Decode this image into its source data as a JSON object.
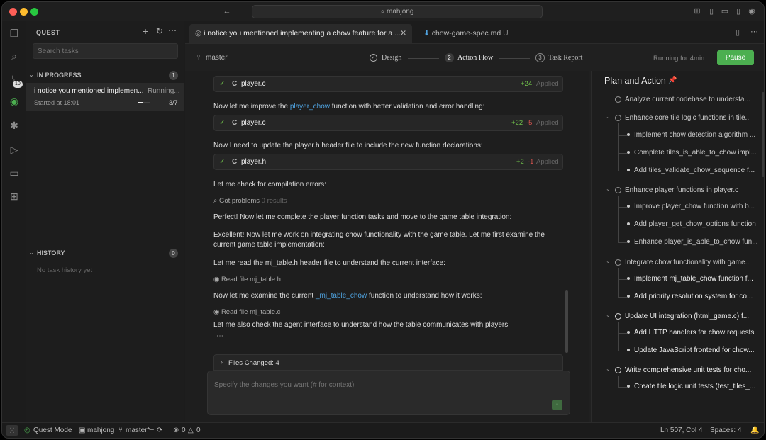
{
  "window": {
    "search_text": "mahjong"
  },
  "activity_bar": {
    "badge": "10"
  },
  "sidebar": {
    "title": "QUEST",
    "search_placeholder": "Search tasks",
    "in_progress_label": "IN PROGRESS",
    "in_progress_count": "1",
    "task": {
      "title": "i notice you mentioned implemen...",
      "status": "Running...",
      "started": "Started at 18:01",
      "progress_text": "3/7",
      "progress_fraction": 0.43
    },
    "history_label": "HISTORY",
    "history_count": "0",
    "history_empty": "No task history yet"
  },
  "tabs": [
    {
      "label": "i notice you mentioned implementing a chow feature for a ..."
    },
    {
      "label": "chow-game-spec.md",
      "suffix": "U"
    }
  ],
  "toolbar": {
    "branch": "master",
    "steps": [
      {
        "num": "1",
        "label": "Design"
      },
      {
        "num": "2",
        "label": "Action Flow"
      },
      {
        "num": "3",
        "label": "Task Report"
      }
    ],
    "running": "Running for 4min",
    "pause_label": "Pause"
  },
  "chat": {
    "files": [
      {
        "lang": "C",
        "name": "player.c",
        "add": "+24",
        "del": "",
        "status": "Applied"
      },
      {
        "lang": "C",
        "name": "player.c",
        "add": "+22",
        "del": "-5",
        "status": "Applied"
      },
      {
        "lang": "C",
        "name": "player.h",
        "add": "+2",
        "del": "-1",
        "status": "Applied"
      }
    ],
    "msg1_pre": "Now let me improve the ",
    "msg1_code": "player_chow",
    "msg1_post": " function with better validation and error handling:",
    "msg2": "Now I need to update the player.h header file to include the new function declarations:",
    "msg3": "Let me check for compilation errors:",
    "tool1": "Got problems",
    "tool1_result": "0 results",
    "msg4": "Perfect! Now let me complete the player function tasks and move to the game table integration:",
    "msg5": "Excellent! Now let me work on integrating chow functionality with the game table. Let me first examine the current game table implementation:",
    "msg6": "Let me read the mj_table.h header file to understand the current interface:",
    "tool2": "Read file mj_table.h",
    "msg7_pre": "Now let me examine the current ",
    "msg7_code": "_mj_table_chow",
    "msg7_post": " function to understand how it works:",
    "tool3": "Read file mj_table.c",
    "msg8": "Let me also check the agent interface to understand how the table communicates with players",
    "files_changed": "Files Changed: 4",
    "input_placeholder": "Specify the changes you want (# for context)"
  },
  "plan": {
    "title": "Plan and Action",
    "items": [
      {
        "text": "Analyze current codebase to understa..."
      },
      {
        "text": "Enhance core tile logic functions in tile..."
      },
      {
        "text": "Implement chow detection algorithm ..."
      },
      {
        "text": "Complete tiles_is_able_to_chow impl..."
      },
      {
        "text": "Add tiles_validate_chow_sequence f..."
      },
      {
        "text": "Enhance player functions in player.c"
      },
      {
        "text": "Improve player_chow function with b..."
      },
      {
        "text": "Add player_get_chow_options function"
      },
      {
        "text": "Enhance player_is_able_to_chow fun..."
      },
      {
        "text": "Integrate chow functionality with game..."
      },
      {
        "text": "Implement mj_table_chow function f..."
      },
      {
        "text": "Add priority resolution system for co..."
      },
      {
        "text": "Update UI integration (html_game.c) f..."
      },
      {
        "text": "Add HTTP handlers for chow requests"
      },
      {
        "text": "Update JavaScript frontend for chow..."
      },
      {
        "text": "Write comprehensive unit tests for cho..."
      },
      {
        "text": "Create tile logic unit tests (test_tiles_..."
      }
    ]
  },
  "status": {
    "mode": "Quest Mode",
    "project": "mahjong",
    "branch": "master*+",
    "errors": "0",
    "warnings": "0",
    "position": "Ln 507, Col 4",
    "spaces": "Spaces: 4"
  },
  "colors": {
    "accent_green": "#4caf50",
    "link_blue": "#4fa3e0",
    "add_green": "#6fbf4a",
    "del_red": "#d9534f"
  }
}
